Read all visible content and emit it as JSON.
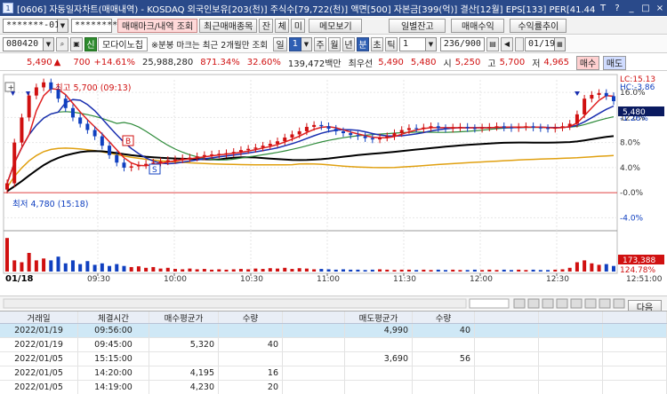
{
  "title": "[0606] 자동일자차트(매매내역) - KOSDAQ 외국인보유[203(천)] 주식수[79,722(천)] 액면[500] 자본금[399(억)] 결산[12월] EPS[133] PER[41.44] ,",
  "titlebar_buttons": [
    "T",
    "?",
    "_",
    "□",
    "×"
  ],
  "toolbar1": {
    "account": "*******-01",
    "password": "********",
    "btn_history": "매매마크/내역 조회",
    "btn_recent": "최근매매종목",
    "btn_jan": "잔",
    "btn_che": "체",
    "btn_mi": "미",
    "btn_memo": "메모보기",
    "btn_daily": "일별잔고",
    "btn_profit": "매매수익",
    "btn_rate": "수익률추이"
  },
  "toolbar2": {
    "code": "080420",
    "badge": "신",
    "stock_name": "모다이노칩",
    "notice": "※분봉 마크는 최근 2개월만 조회",
    "period_il": "일",
    "period_num": "1",
    "periods": [
      "주",
      "월",
      "년",
      "분",
      "초",
      "틱"
    ],
    "tick_value": "1",
    "count": "236/900",
    "date": "01/19"
  },
  "quote": {
    "price": "5,490",
    "arrow": "▲",
    "change": "700",
    "change_pct": "+14.61%",
    "volume": "25,988,280",
    "vol_ratio": "871.34%",
    "turnover": "32.60%",
    "amount": "139,472백만",
    "best_label": "최우선",
    "best_sell": "5,490",
    "best_buy": "5,480",
    "open_label": "시",
    "open": "5,250",
    "high_label": "고",
    "high": "5,700",
    "low_label": "저",
    "low": "4,965",
    "buy_btn": "매수",
    "sell_btn": "매도"
  },
  "chart_labels": {
    "max_label": "최고 5,700 (09:13)",
    "min_label": "최저 4,780 (15:18)",
    "lc": "LC:15.13",
    "hc": "HC:-3.86",
    "current_pct": "-1.26%",
    "current_price": "5,480",
    "vol_current": "173,388",
    "vol_pct": "124.78%",
    "date_label": "01/18",
    "corner_label": "12:51:00",
    "signal_b": "B",
    "signal_s": "S"
  },
  "chart_data": {
    "type": "line",
    "y_ticks": [
      "16.0%",
      "12.0%",
      "8.0%",
      "4.0%",
      "-0.0%",
      "-4.0%"
    ],
    "y_values": [
      16,
      12,
      8,
      4,
      0,
      -4
    ],
    "x_ticks": [
      "09:30",
      "10:00",
      "10:30",
      "11:00",
      "11:30",
      "12:00",
      "12:30"
    ],
    "ylim": [
      -5.5,
      18
    ],
    "price_pct": [
      1.5,
      8,
      12,
      15.5,
      16.8,
      17.6,
      16.5,
      15,
      13.5,
      12,
      11,
      10,
      9,
      7.5,
      6,
      4.8,
      4,
      4.2,
      4.4,
      4.6,
      4.8,
      5,
      5.2,
      5.3,
      5.5,
      5.6,
      5.8,
      6,
      6.1,
      6.2,
      6.3,
      6.5,
      6.8,
      7,
      7.2,
      7.5,
      7.8,
      8.2,
      8.8,
      9.3,
      9.8,
      10.5,
      10.8,
      10.6,
      10.2,
      9.8,
      9.5,
      9.2,
      9,
      8.7,
      8.5,
      8.8,
      9,
      9.5,
      10,
      10.3,
      10.2,
      10.4,
      10.6,
      10.3,
      10.2,
      10.4,
      10.5,
      10.3,
      10.2,
      10.4,
      10.5,
      10.6,
      10.4,
      10.3,
      10.5,
      10.6,
      10.4,
      10.3,
      10.2,
      10.4,
      10.6,
      11,
      12.5,
      15,
      15.6,
      15.9,
      15.4,
      14.6
    ],
    "vol_bars": [
      0.9,
      0.3,
      0.25,
      0.5,
      0.3,
      0.35,
      0.3,
      0.4,
      0.22,
      0.3,
      0.2,
      0.28,
      0.18,
      0.22,
      0.15,
      0.2,
      0.15,
      0.12,
      0.14,
      0.1,
      0.12,
      0.08,
      0.1,
      0.07,
      0.06,
      0.08,
      0.06,
      0.07,
      0.05,
      0.06,
      0.05,
      0.06,
      0.07,
      0.06,
      0.08,
      0.07,
      0.09,
      0.08,
      0.1,
      0.07,
      0.09,
      0.08,
      0.06,
      0.07,
      0.06,
      0.05,
      0.06,
      0.05,
      0.05,
      0.04,
      0.05,
      0.06,
      0.05,
      0.04,
      0.05,
      0.05,
      0.04,
      0.05,
      0.04,
      0.05,
      0.04,
      0.05,
      0.04,
      0.04,
      0.05,
      0.04,
      0.05,
      0.04,
      0.05,
      0.04,
      0.05,
      0.04,
      0.05,
      0.04,
      0.04,
      0.05,
      0.06,
      0.1,
      0.25,
      0.3,
      0.22,
      0.18,
      0.2,
      0.15
    ]
  },
  "colors": {
    "up": "#d01010",
    "down": "#1040c0",
    "ma_red": "#e02020",
    "ma_blue": "#1a2fb0",
    "ma_green": "#2e8b3a",
    "ma_black": "#000000",
    "ma_orange": "#e0a010"
  },
  "table": {
    "headers": [
      "거래일",
      "체결시간",
      "매수평균가",
      "수량",
      "",
      "매도평균가",
      "수량",
      "",
      "",
      ""
    ],
    "next_btn": "다음",
    "rows": [
      [
        "2022/01/19",
        "09:56:00",
        "",
        "",
        "",
        "4,990",
        "40",
        "",
        "",
        ""
      ],
      [
        "2022/01/19",
        "09:45:00",
        "5,320",
        "40",
        "",
        "",
        "",
        "",
        "",
        ""
      ],
      [
        "2022/01/05",
        "15:15:00",
        "",
        "",
        "",
        "3,690",
        "56",
        "",
        "",
        ""
      ],
      [
        "2022/01/05",
        "14:20:00",
        "4,195",
        "16",
        "",
        "",
        "",
        "",
        "",
        ""
      ],
      [
        "2022/01/05",
        "14:19:00",
        "4,230",
        "20",
        "",
        "",
        "",
        "",
        "",
        ""
      ]
    ]
  }
}
